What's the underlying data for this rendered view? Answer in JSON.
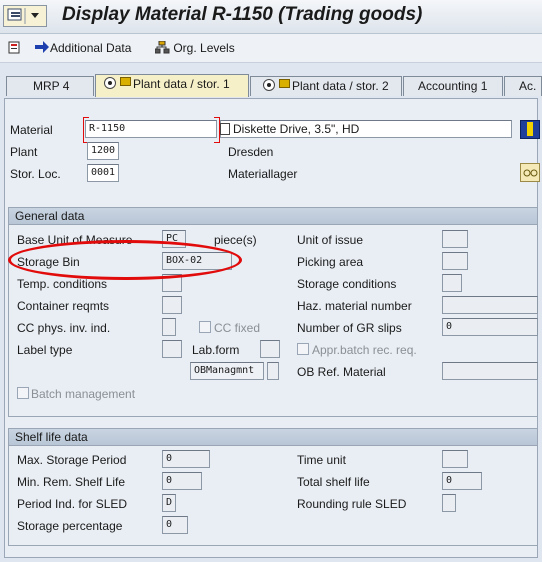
{
  "window": {
    "title": "Display Material R-1150 (Trading goods)"
  },
  "toolbar": {
    "additional_data": "Additional Data",
    "org_levels": "Org. Levels"
  },
  "tabs": [
    "MRP 4",
    "Plant data / stor. 1",
    "Plant data / stor. 2",
    "Accounting 1",
    "Ac."
  ],
  "header": {
    "material_label": "Material",
    "material_value": "R-1150",
    "material_desc": "Diskette Drive, 3.5\", HD",
    "plant_label": "Plant",
    "plant_value": "1200",
    "plant_name": "Dresden",
    "storloc_label": "Stor. Loc.",
    "storloc_value": "0001",
    "storloc_name": "Materiallager"
  },
  "general": {
    "title": "General data",
    "base_uom_label": "Base Unit of Measure",
    "base_uom_value": "PC",
    "base_uom_text": "piece(s)",
    "storage_bin_label": "Storage Bin",
    "storage_bin_value": "BOX-02",
    "temp_label": "Temp. conditions",
    "container_label": "Container reqmts",
    "cc_phys_label": "CC phys. inv. ind.",
    "cc_fixed_label": "CC fixed",
    "label_type_label": "Label type",
    "lab_form_label": "Lab.form",
    "obmanag_label": "OBManagmnt",
    "batch_label": "Batch management",
    "unit_issue_label": "Unit of issue",
    "picking_label": "Picking area",
    "storage_cond_label": "Storage conditions",
    "haz_label": "Haz. material number",
    "gr_slips_label": "Number of GR slips",
    "gr_slips_value": "0",
    "appr_batch_label": "Appr.batch rec. req.",
    "ob_ref_label": "OB Ref. Material"
  },
  "shelf": {
    "title": "Shelf life data",
    "max_storage_label": "Max. Storage Period",
    "max_storage_value": "0",
    "min_rem_label": "Min. Rem. Shelf Life",
    "min_rem_value": "0",
    "period_ind_label": "Period Ind. for SLED",
    "period_ind_value": "D",
    "storage_pct_label": "Storage percentage",
    "storage_pct_value": "0",
    "time_unit_label": "Time unit",
    "total_shelf_label": "Total shelf life",
    "total_shelf_value": "0",
    "rounding_label": "Rounding rule SLED"
  },
  "colors": {
    "annotation": "#e20b0b",
    "active_tab": "#f6f0c9",
    "group_header": "#c2cedc"
  }
}
